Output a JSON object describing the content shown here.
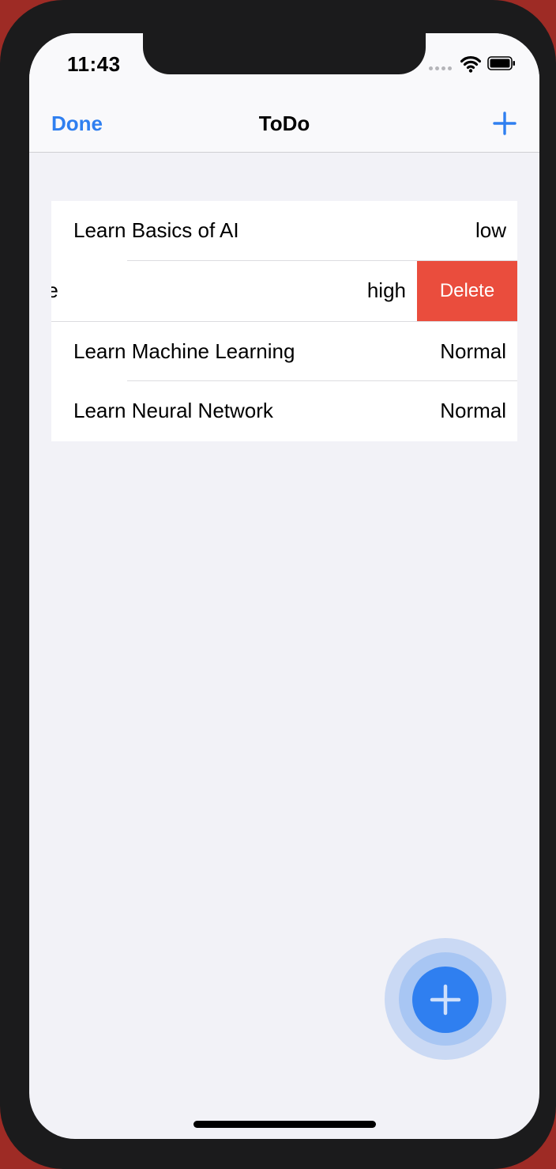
{
  "status_bar": {
    "time": "11:43"
  },
  "nav": {
    "done_label": "Done",
    "title": "ToDo",
    "add_icon": "plus-icon"
  },
  "todos": [
    {
      "title": "Learn Basics of AI",
      "priority": "low"
    },
    {
      "title": "Learn Data Science",
      "visible_title": "ata Science",
      "priority": "high",
      "delete_label": "Delete"
    },
    {
      "title": "Learn Machine Learning",
      "priority": "Normal"
    },
    {
      "title": "Learn Neural Network",
      "priority": "Normal"
    }
  ],
  "fab": {
    "icon": "plus-icon"
  },
  "colors": {
    "accent": "#2f7ff0",
    "delete": "#ea4d3d",
    "background": "#f2f2f7"
  }
}
